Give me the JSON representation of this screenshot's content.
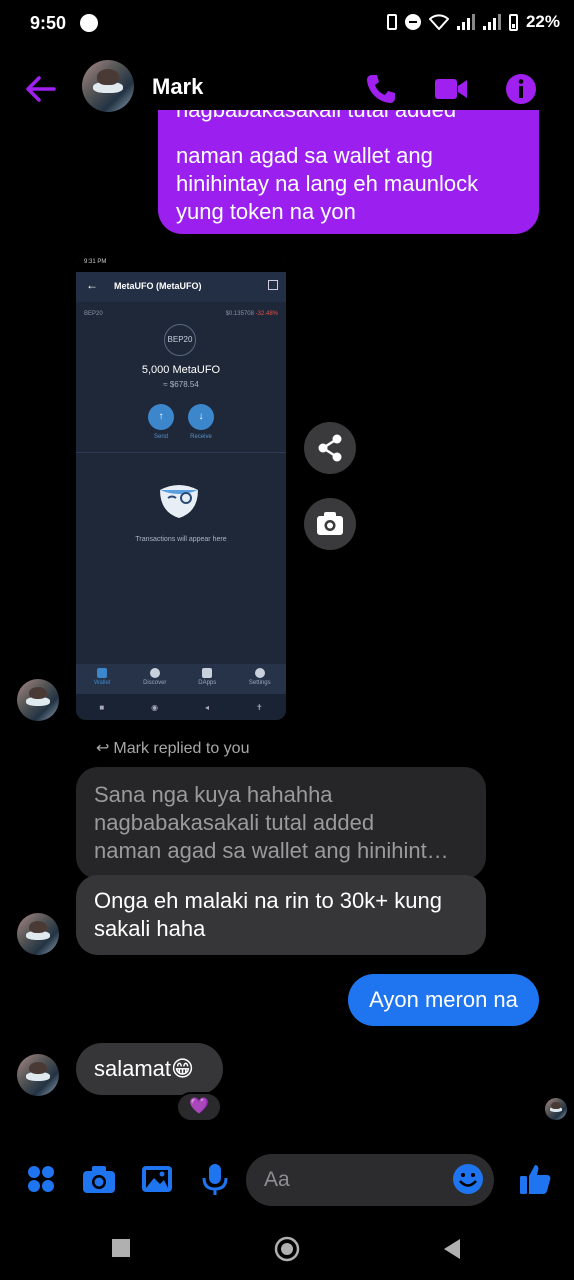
{
  "status_bar": {
    "time": "9:50",
    "battery": "22%"
  },
  "header": {
    "contact_name": "Mark"
  },
  "messages": {
    "sent_top_partial_first": "nagbabakasakali tutal added",
    "sent_top_lines": [
      "naman agad sa wallet ang",
      "hinihintay na lang eh maunlock",
      "yung token na yon"
    ],
    "reply_note": "Mark replied to you",
    "quoted_lines": [
      "Sana nga kuya hahahha",
      "nagbabakasakali tutal added",
      "naman agad sa wallet ang hinihint…"
    ],
    "received_reply_lines": [
      "Onga eh malaki na rin to 30k+ kung",
      "sakali haha"
    ],
    "sent_short": "Ayon meron na",
    "received_thanks": "salamat😁",
    "reaction": "💜"
  },
  "screenshot": {
    "status_time": "9:31 PM",
    "title": "MetaUFO (MetaUFO)",
    "network": "BEP20",
    "price": "$0.135708",
    "change": "-32.48%",
    "token_badge": "BEP20",
    "amount": "5,000 MetaUFO",
    "fiat": "≈ $678.54",
    "send_label": "Send",
    "receive_label": "Receive",
    "empty_text": "Transactions will appear here",
    "tabs": [
      "Wallet",
      "Discover",
      "DApps",
      "Settings"
    ]
  },
  "composer": {
    "placeholder": "Aa"
  },
  "colors": {
    "sent_purple": "#9b20f0",
    "sent_blue": "#1f74ef",
    "accent_purple": "#a020f0",
    "messenger_blue": "#1f74ef"
  }
}
